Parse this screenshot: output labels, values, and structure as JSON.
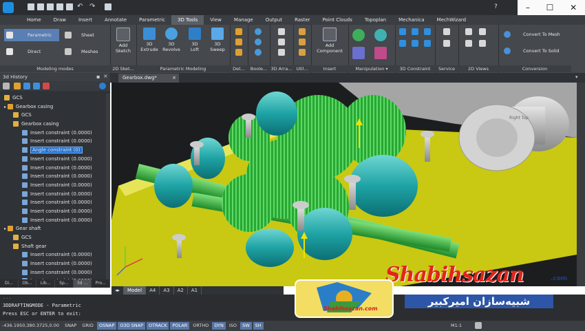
{
  "app": {
    "ribbon_tabs": [
      "Home",
      "Draw",
      "Insert",
      "Annotate",
      "Parametric",
      "3D Tools",
      "View",
      "Manage",
      "Output",
      "Raster",
      "Point Clouds",
      "Topoplan",
      "Mechanica",
      "MechWizard"
    ],
    "active_tab": "3D Tools",
    "help": "?"
  },
  "ribbon": {
    "groups": {
      "modeling_modes": "Modeling modes",
      "sketch": "2D Sket...",
      "parametric_modeling": "Parametric Modeling",
      "det": "Det...",
      "boolean": "Boole...",
      "arr": "3D Arra...",
      "util": "Util...",
      "insert": "Insert",
      "manipulation": "Manipulation ▾",
      "constraint": "3D Constraint",
      "service": "Service",
      "views2d": "2D Views",
      "conversion": "Conversion"
    },
    "buttons": {
      "parametric": "Parametric",
      "direct": "Direct",
      "sheet": "Sheet",
      "meshes": "Meshes",
      "add_sketch": [
        "Add",
        "Sketch"
      ],
      "extrude": [
        "3D",
        "Extrude"
      ],
      "revolve": [
        "3D",
        "Revolve"
      ],
      "loft": [
        "3D",
        "Loft"
      ],
      "sweep": [
        "3D",
        "Sweep"
      ],
      "add_component": [
        "Add",
        "Component"
      ],
      "convert_mesh": "Convert To Mesh",
      "convert_solid": "Convert To Solid"
    }
  },
  "history": {
    "title": "3d History",
    "items": [
      {
        "label": "GCS",
        "indent": 1,
        "icon": "folder"
      },
      {
        "label": "Gearbox casing",
        "indent": 1,
        "icon": "part"
      },
      {
        "label": "GCS",
        "indent": 2,
        "icon": "folder"
      },
      {
        "label": "Gearbox casing",
        "indent": 2,
        "icon": "folder"
      },
      {
        "label": "Insert constraint (0.0000)",
        "indent": 3,
        "icon": "constraint"
      },
      {
        "label": "Insert constraint (0.0000)",
        "indent": 3,
        "icon": "constraint"
      },
      {
        "label": "Angle constraint (0)",
        "indent": 3,
        "icon": "constraint",
        "selected": true
      },
      {
        "label": "Insert constraint (0.0000)",
        "indent": 3,
        "icon": "constraint"
      },
      {
        "label": "Insert constraint (0.0000)",
        "indent": 3,
        "icon": "constraint"
      },
      {
        "label": "Insert constraint (0.0000)",
        "indent": 3,
        "icon": "constraint"
      },
      {
        "label": "Insert constraint (0.0000)",
        "indent": 3,
        "icon": "constraint"
      },
      {
        "label": "Insert constraint (0.0000)",
        "indent": 3,
        "icon": "constraint"
      },
      {
        "label": "Insert constraint (0.0000)",
        "indent": 3,
        "icon": "constraint"
      },
      {
        "label": "Insert constraint (0.0000)",
        "indent": 3,
        "icon": "constraint"
      },
      {
        "label": "Insert constraint (0.0000)",
        "indent": 3,
        "icon": "constraint"
      },
      {
        "label": "Gear shaft",
        "indent": 1,
        "icon": "part"
      },
      {
        "label": "GCS",
        "indent": 2,
        "icon": "folder"
      },
      {
        "label": "Shaft gear",
        "indent": 2,
        "icon": "folder"
      },
      {
        "label": "Insert constraint (0.0000)",
        "indent": 3,
        "icon": "constraint"
      },
      {
        "label": "Insert constraint (0.0000)",
        "indent": 3,
        "icon": "constraint"
      },
      {
        "label": "Insert constraint (0.0000)",
        "indent": 3,
        "icon": "constraint"
      },
      {
        "label": "Insert constraint (0.0000)",
        "indent": 3,
        "icon": "constraint"
      }
    ],
    "bottom_tabs": [
      "Di...",
      "Ob...",
      "Lib...",
      "Sp...",
      "3d ...",
      "Pro..."
    ],
    "active_bottom_tab": "3d ..."
  },
  "document": {
    "tab": "Gearbox.dwg*",
    "layout_tabs": [
      "Model",
      "A4",
      "A3",
      "A2",
      "A1"
    ],
    "active_layout": "Model"
  },
  "viewport": {
    "label": "Right Top"
  },
  "command": {
    "lines": [
      "...",
      "3DDRAFTINGMODE - Parametric",
      "Press ESC or ENTER to exit:"
    ]
  },
  "status": {
    "coords": "-436.1950,380.3725,0.00",
    "toggles": [
      {
        "label": "SNAP",
        "on": false
      },
      {
        "label": "GRID",
        "on": false
      },
      {
        "label": "OSNAP",
        "on": true
      },
      {
        "label": "O3D SNAP",
        "on": true
      },
      {
        "label": "OTRACK",
        "on": true
      },
      {
        "label": "POLAR",
        "on": true
      },
      {
        "label": "ORTHO",
        "on": false
      },
      {
        "label": "DYN",
        "on": true
      },
      {
        "label": "ISO",
        "on": false
      },
      {
        "label": "SW",
        "on": true
      },
      {
        "label": "SH",
        "on": true
      }
    ],
    "scale": "M1:1"
  },
  "watermark": {
    "latin": "Shabihsazan",
    "com": ".com",
    "persian": "شبیه‌سازان امیرکبیر",
    "small": "Shabihsazan.com"
  },
  "colors": {
    "gear": "#2fb53a",
    "cyan": "#1fa7a8",
    "base": "#c9c813",
    "selection": "#1e6fd0"
  }
}
